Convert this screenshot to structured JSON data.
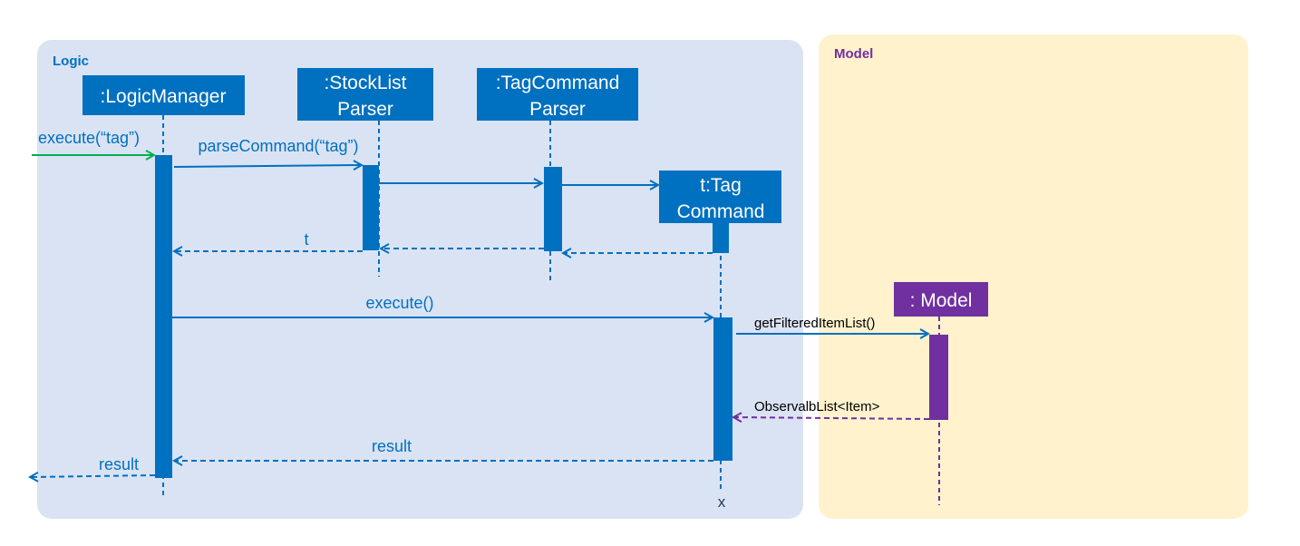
{
  "frames": {
    "logic": "Logic",
    "model": "Model"
  },
  "participants": {
    "logic_manager": ":LogicManager",
    "stocklist_parser": [
      ":StockList",
      "Parser"
    ],
    "tagcommand_parser": [
      ":TagCommand",
      "Parser"
    ],
    "tag_command": [
      "t:Tag",
      "Command"
    ],
    "model": ": Model"
  },
  "messages": {
    "execute_tag": "execute(“tag”)",
    "parse_command": "parseCommand(“tag”)",
    "return_t": "t",
    "execute": "execute()",
    "get_filtered": "getFilteredItemList()",
    "observable_list": "ObservalbList<Item>",
    "result_inner": "result",
    "result_outer": "result",
    "destroy": "x"
  },
  "colors": {
    "logic_bg": "#dae3f3",
    "model_bg": "#fff2cc",
    "logic_accent": "#0070c0",
    "model_accent": "#7030a0",
    "entry_arrow": "#00b050"
  }
}
